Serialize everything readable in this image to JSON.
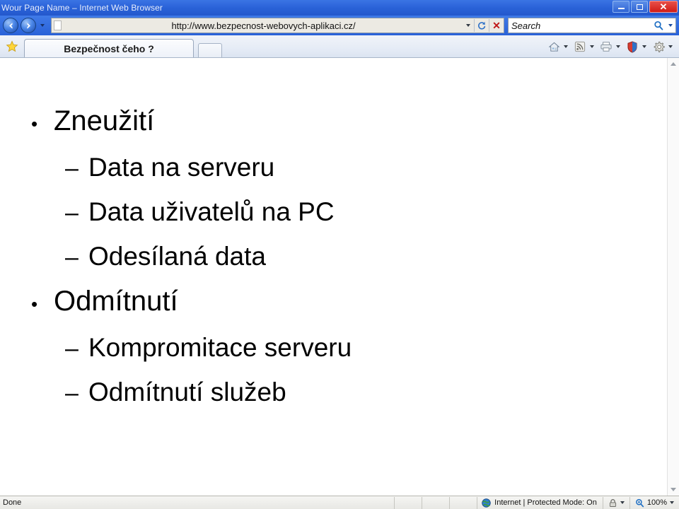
{
  "window": {
    "title": "Wour Page Name – Internet Web Browser",
    "minimize_label": "Minimize",
    "maximize_label": "Maximize",
    "close_label": "✕"
  },
  "navigation": {
    "back_label": "Back",
    "forward_label": "Forward",
    "history_dropdown_label": "Recent Pages",
    "url": "http://www.bezpecnost-webovych-aplikaci.cz/",
    "url_dropdown_label": "Address history",
    "refresh_label": "Refresh",
    "stop_label": "✕"
  },
  "search": {
    "placeholder": "Search",
    "icon": "search-icon",
    "dropdown_label": "Search providers"
  },
  "tabs": {
    "favorites_label": "Favorites",
    "items": [
      {
        "title": "Bezpečnost čeho ?",
        "active": true
      }
    ],
    "new_tab_label": "New Tab"
  },
  "toolbar": {
    "items": [
      {
        "name": "home-icon",
        "label": "Home"
      },
      {
        "name": "rss-icon",
        "label": "Feeds"
      },
      {
        "name": "print-icon",
        "label": "Print"
      },
      {
        "name": "safety-shield-icon",
        "label": "Safety"
      },
      {
        "name": "gear-icon",
        "label": "Tools"
      }
    ]
  },
  "page_content": {
    "bullets": [
      {
        "level": 1,
        "marker": "•",
        "text": "Zneužití"
      },
      {
        "level": 2,
        "marker": "–",
        "text": "Data na serveru"
      },
      {
        "level": 2,
        "marker": "–",
        "text": "Data uživatelů na PC"
      },
      {
        "level": 2,
        "marker": "–",
        "text": "Odesílaná data"
      },
      {
        "level": 1,
        "marker": "•",
        "text": "Odmítnutí"
      },
      {
        "level": 2,
        "marker": "–",
        "text": "Kompromitace serveru"
      },
      {
        "level": 2,
        "marker": "–",
        "text": "Odmítnutí služeb"
      }
    ]
  },
  "statusbar": {
    "status": "Done",
    "zone": "Internet | Protected Mode: On",
    "zone_icon": "globe-icon",
    "privacy_icon": "padlock-icon",
    "privacy_dropdown_label": "Privacy settings",
    "zoom_icon": "zoom-magnifier-icon",
    "zoom_level": "100%",
    "zoom_dropdown_label": "Change zoom level"
  },
  "scrollbar": {
    "up_label": "Scroll up",
    "down_label": "Scroll down",
    "track_label": "Scroll track"
  },
  "colors": {
    "title_bar": "#2a62d8",
    "close_button": "#d01c16",
    "star": "#ffd63a",
    "page_background": "#ffffff",
    "text": "#000000"
  }
}
